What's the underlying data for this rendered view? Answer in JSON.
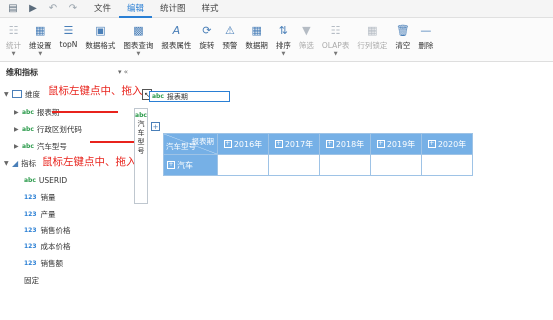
{
  "menubar": {
    "icons": [
      "save-icon",
      "play-icon",
      "undo-icon",
      "redo-icon"
    ],
    "items": [
      "文件",
      "编辑",
      "统计图",
      "样式"
    ],
    "active": "编辑"
  },
  "ribbon": {
    "buttons": [
      {
        "label": "统计",
        "icon": "statistics-icon",
        "caret": true,
        "disabled": true
      },
      {
        "label": "维设置",
        "icon": "dimension-settings-icon",
        "caret": true,
        "disabled": false
      },
      {
        "label": "topN",
        "icon": "topn-icon",
        "caret": false,
        "disabled": false
      },
      {
        "label": "数据格式",
        "icon": "data-format-icon",
        "caret": false,
        "disabled": false
      },
      {
        "label": "图表查询",
        "icon": "chart-query-icon",
        "caret": true,
        "disabled": false
      },
      {
        "label": "报表属性",
        "icon": "report-properties-icon",
        "caret": false,
        "disabled": false
      },
      {
        "label": "旋转",
        "icon": "rotate-icon",
        "caret": false,
        "disabled": false
      },
      {
        "label": "预警",
        "icon": "warning-icon",
        "caret": false,
        "disabled": false
      },
      {
        "label": "数据期",
        "icon": "data-period-icon",
        "caret": false,
        "disabled": false
      },
      {
        "label": "排序",
        "icon": "sort-icon",
        "caret": true,
        "disabled": false
      },
      {
        "label": "筛选",
        "icon": "filter-icon",
        "caret": false,
        "disabled": true
      },
      {
        "label": "OLAP表",
        "icon": "olap-table-icon",
        "caret": true,
        "disabled": true
      },
      {
        "label": "行列锁定",
        "icon": "row-column-lock-icon",
        "caret": false,
        "disabled": true
      },
      {
        "label": "清空",
        "icon": "clear-icon",
        "caret": false,
        "disabled": false
      },
      {
        "label": "删除",
        "icon": "delete-icon",
        "caret": false,
        "disabled": false
      }
    ]
  },
  "panel": {
    "title": "维和指标",
    "controls": "▾ «"
  },
  "tree": {
    "dimension_root": "维度",
    "dimensions": [
      "报表期",
      "行政区划代码",
      "汽车型号"
    ],
    "measure_root": "指标",
    "measures": [
      "USERID",
      "销量",
      "产量",
      "销售价格",
      "成本价格",
      "销售额"
    ],
    "fixed": "固定"
  },
  "annotations": {
    "top": "鼠标左键点中、拖入",
    "bottom": "鼠标左键点中、拖入"
  },
  "drag": {
    "ghost_label": "报表期",
    "mid_column_label": "汽车型号",
    "expand_symbol": "+"
  },
  "pivot": {
    "col_header": "报表期",
    "row_header": "汽车型号",
    "years": [
      "2016年",
      "2017年",
      "2018年",
      "2019年",
      "2020年"
    ],
    "row_label": "汽车"
  },
  "colors": {
    "accent": "#2a7fd4",
    "header_fill": "#76b0e6",
    "annotation": "#e8231c"
  }
}
